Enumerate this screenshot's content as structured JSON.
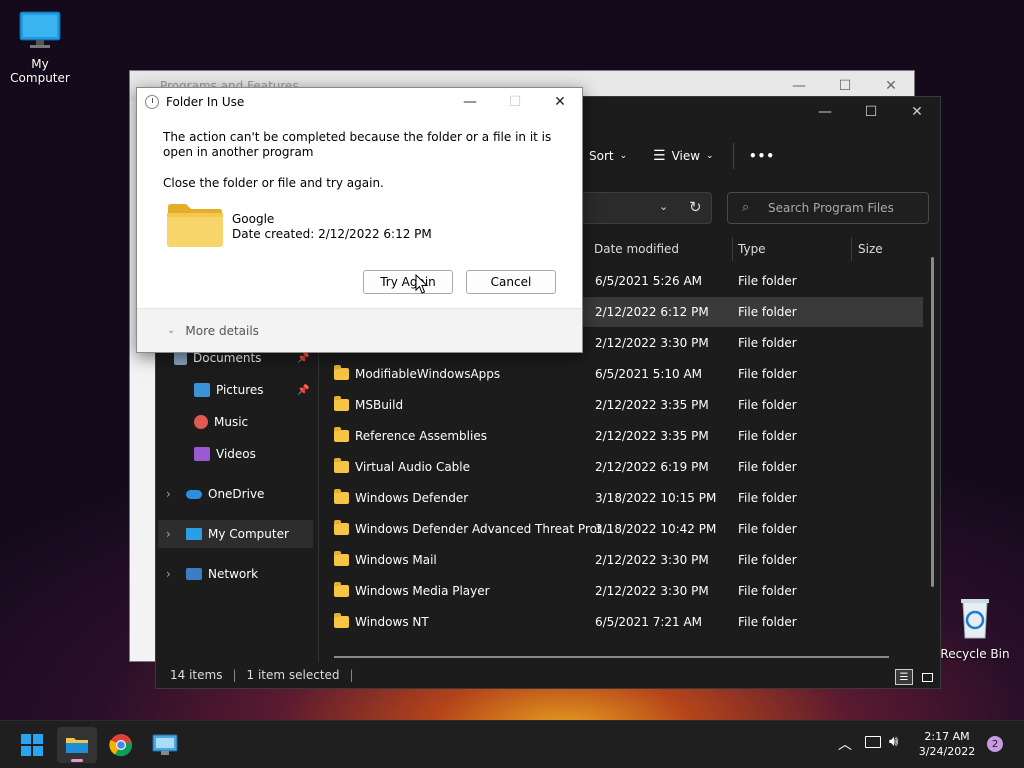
{
  "desktop": {
    "my_computer_label": "My Computer",
    "recycle_bin_label": "Recycle Bin"
  },
  "back_window": {
    "title": "Programs and Features"
  },
  "explorer": {
    "toolbar": {
      "sort_label": "Sort",
      "view_label": "View",
      "more_label": "•••"
    },
    "search_placeholder": "Search Program Files",
    "columns": [
      "Date modified",
      "Type",
      "Size"
    ],
    "sidebar": [
      {
        "label": "Documents",
        "pinned": true
      },
      {
        "label": "Pictures",
        "pinned": true
      },
      {
        "label": "Music",
        "pinned": false
      },
      {
        "label": "Videos",
        "pinned": false
      },
      {
        "label": "OneDrive",
        "pinned": false
      },
      {
        "label": "My Computer",
        "pinned": false
      },
      {
        "label": "Network",
        "pinned": false
      }
    ],
    "rows": [
      {
        "name": "",
        "date": "6/5/2021 5:26 AM",
        "type": "File folder"
      },
      {
        "name": "",
        "date": "2/12/2022 6:12 PM",
        "type": "File folder"
      },
      {
        "name": "",
        "date": "2/12/2022 3:30 PM",
        "type": "File folder"
      },
      {
        "name": "ModifiableWindowsApps",
        "date": "6/5/2021 5:10 AM",
        "type": "File folder"
      },
      {
        "name": "MSBuild",
        "date": "2/12/2022 3:35 PM",
        "type": "File folder"
      },
      {
        "name": "Reference Assemblies",
        "date": "2/12/2022 3:35 PM",
        "type": "File folder"
      },
      {
        "name": "Virtual Audio Cable",
        "date": "2/12/2022 6:19 PM",
        "type": "File folder"
      },
      {
        "name": "Windows Defender",
        "date": "3/18/2022 10:15 PM",
        "type": "File folder"
      },
      {
        "name": "Windows Defender Advanced Threat Prot...",
        "date": "3/18/2022 10:42 PM",
        "type": "File folder"
      },
      {
        "name": "Windows Mail",
        "date": "2/12/2022 3:30 PM",
        "type": "File folder"
      },
      {
        "name": "Windows Media Player",
        "date": "2/12/2022 3:30 PM",
        "type": "File folder"
      },
      {
        "name": "Windows NT",
        "date": "6/5/2021 7:21 AM",
        "type": "File folder"
      }
    ],
    "status": {
      "items": "14 items",
      "selected": "1 item selected"
    }
  },
  "dialog": {
    "title": "Folder In Use",
    "message": "The action can't be completed because the folder or a file in it is open in another program",
    "instruction": "Close the folder or file and try again.",
    "folder_name": "Google",
    "folder_date": "Date created: 2/12/2022 6:12 PM",
    "try_again_label": "Try Again",
    "cancel_label": "Cancel",
    "more_details_label": "More details"
  },
  "taskbar": {
    "time": "2:17 AM",
    "date": "3/24/2022",
    "notification_count": "2"
  },
  "colors": {
    "accent": "#0078d4",
    "folder": "#f6c544"
  }
}
